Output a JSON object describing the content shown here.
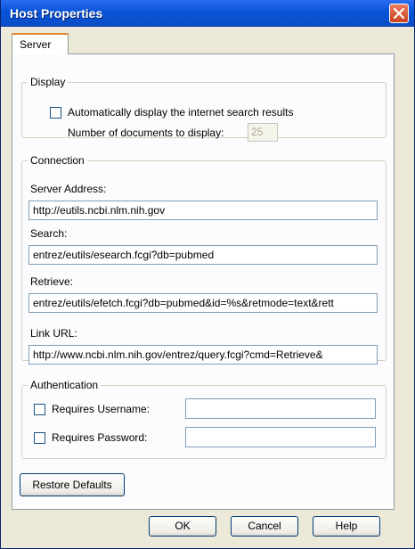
{
  "window": {
    "title": "Host Properties"
  },
  "tabs": [
    {
      "label": "Server"
    }
  ],
  "display": {
    "legend": "Display",
    "auto_display_label": "Automatically display the internet search results",
    "auto_display_checked": false,
    "num_docs_label": "Number of documents to display:",
    "num_docs_value": "25"
  },
  "connection": {
    "legend": "Connection",
    "server_address_label": "Server Address:",
    "server_address_value": "http://eutils.ncbi.nlm.nih.gov",
    "search_label": "Search:",
    "search_value": "entrez/eutils/esearch.fcgi?db=pubmed",
    "retrieve_label": "Retrieve:",
    "retrieve_value": "entrez/eutils/efetch.fcgi?db=pubmed&id=%s&retmode=text&rett",
    "link_url_label": "Link URL:",
    "link_url_value": "http://www.ncbi.nlm.nih.gov/entrez/query.fcgi?cmd=Retrieve&"
  },
  "authentication": {
    "legend": "Authentication",
    "requires_username_label": "Requires Username:",
    "requires_username_checked": false,
    "username_value": "",
    "requires_password_label": "Requires Password:",
    "requires_password_checked": false,
    "password_value": ""
  },
  "buttons": {
    "restore_defaults": "Restore Defaults",
    "ok": "OK",
    "cancel": "Cancel",
    "help": "Help"
  },
  "colors": {
    "titlebar": "#0854D8",
    "dialog_bg": "#ECE9D8",
    "tab_accent": "#E68B2C",
    "close_button": "#C8421F"
  },
  "icons": {
    "close": "close-icon"
  }
}
